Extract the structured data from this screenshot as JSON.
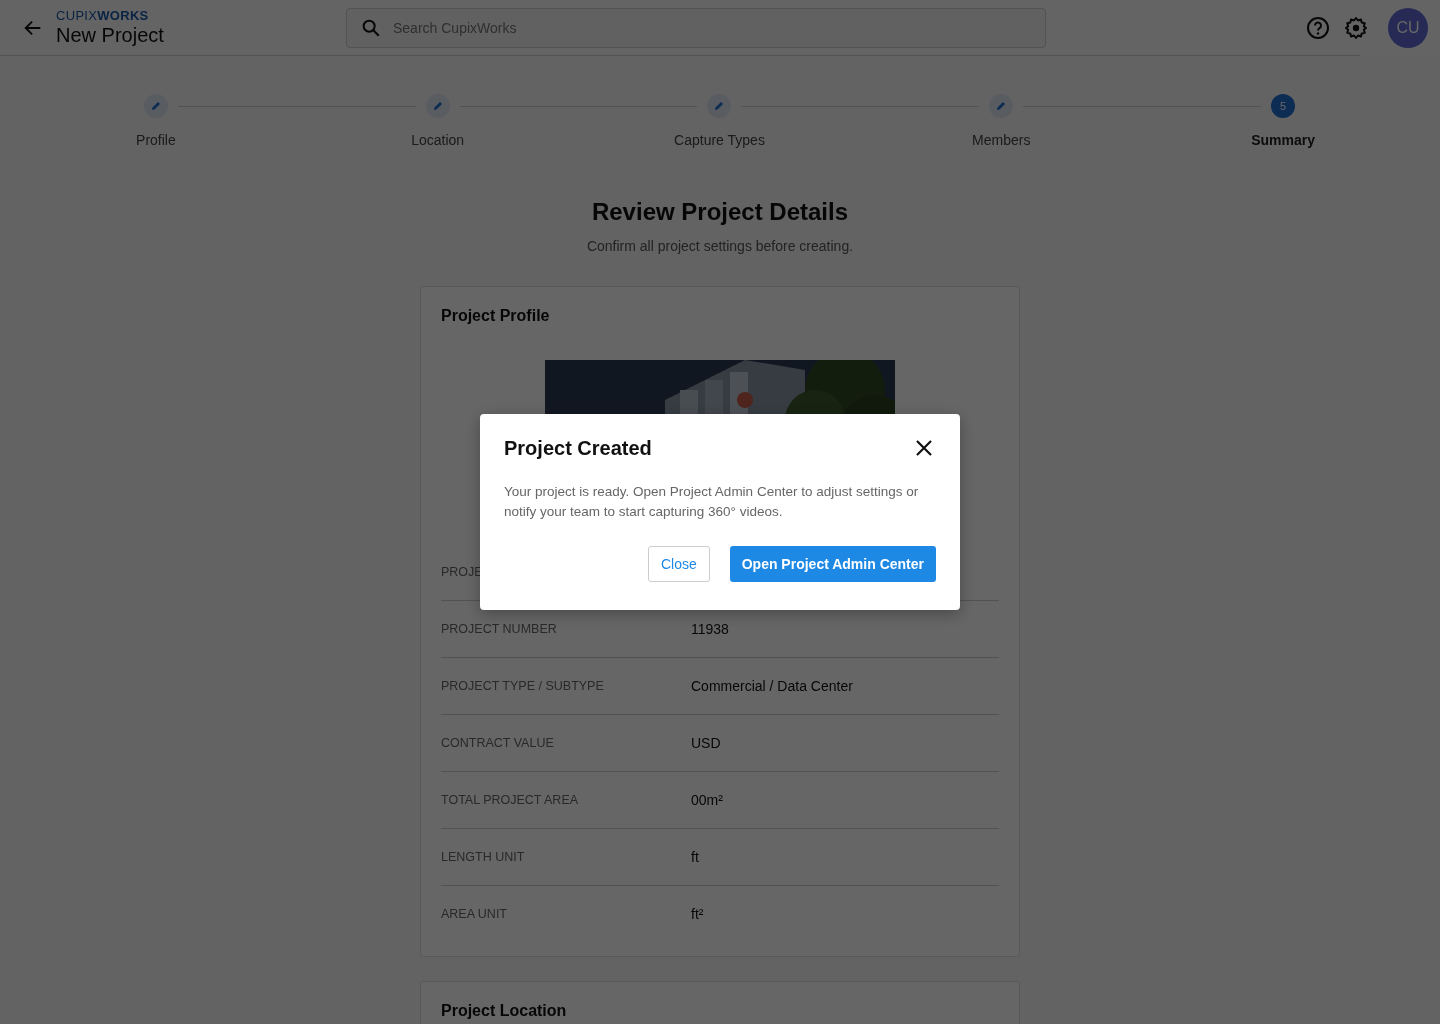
{
  "header": {
    "brand": "CUPIX**WORKS**",
    "title": "New Project",
    "search": {
      "placeholder": "Search CupixWorks"
    },
    "avatar": "CU"
  },
  "stepper": [
    {
      "label": "Profile",
      "kind": "edited",
      "selected": false
    },
    {
      "label": "Location",
      "kind": "edited",
      "selected": false
    },
    {
      "label": "Capture Types",
      "kind": "edited",
      "selected": false
    },
    {
      "label": "Members",
      "kind": "edited",
      "selected": false
    },
    {
      "label": "Summary",
      "kind": "numbered",
      "number": "5",
      "selected": true
    }
  ],
  "page": {
    "title": "Review Project Details",
    "subtitle": "Confirm all project settings before creating."
  },
  "profile_card": {
    "title": "Project Profile",
    "rows": [
      {
        "label": "PROJE"
      },
      {
        "label": "PROJECT NUMBER",
        "value": "11938"
      },
      {
        "label": "PROJECT TYPE / SUBTYPE",
        "value": "Commercial / Data Center"
      },
      {
        "label": "CONTRACT VALUE",
        "value": "USD"
      },
      {
        "label": "TOTAL PROJECT AREA",
        "value": "00m²"
      },
      {
        "label": "LENGTH UNIT",
        "value": "ft"
      },
      {
        "label": "AREA UNIT",
        "value": "ft²"
      }
    ]
  },
  "location_card": {
    "title": "Project Location"
  },
  "dialog": {
    "title": "Project Created",
    "message": "Your project is ready. Open Project Admin Center to adjust settings or notify your team to start capturing 360° videos.",
    "buttons": [
      {
        "label": "Close",
        "kind": "secondary"
      },
      {
        "label": "Open Project Admin Center",
        "kind": "primary"
      }
    ]
  }
}
